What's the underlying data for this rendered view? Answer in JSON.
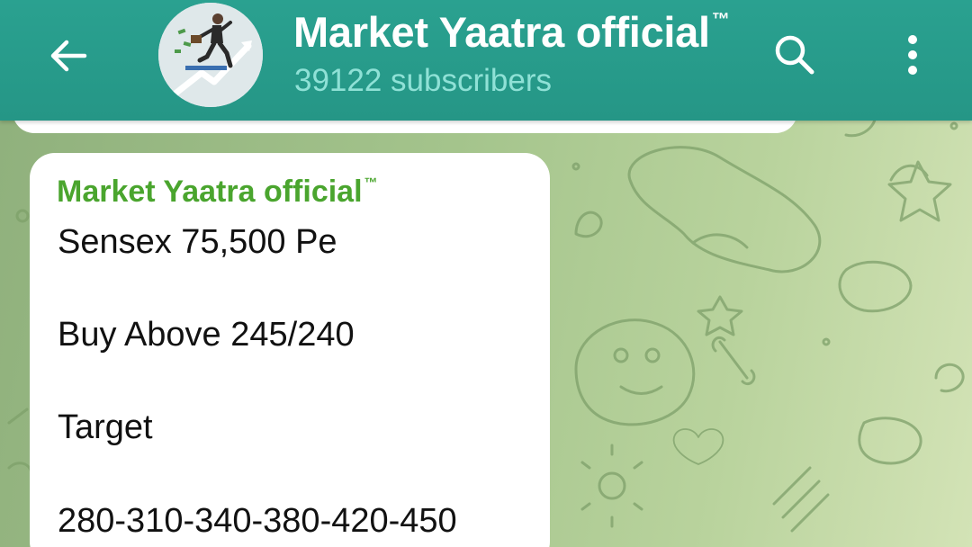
{
  "header": {
    "back_icon": "arrow-left-icon",
    "channel_name": "Market Yaatra official",
    "trademark": "™",
    "subscribers": "39122 subscribers",
    "search_icon": "search-icon",
    "more_icon": "more-vertical-icon",
    "background_color": "#2a9d8f"
  },
  "message": {
    "sender": "Market Yaatra official",
    "sender_trademark": "™",
    "sender_color": "#4aa52e",
    "lines": [
      "Sensex 75,500 Pe",
      "Buy Above 245/240",
      "Target",
      "280-310-340-380-420-450"
    ]
  }
}
